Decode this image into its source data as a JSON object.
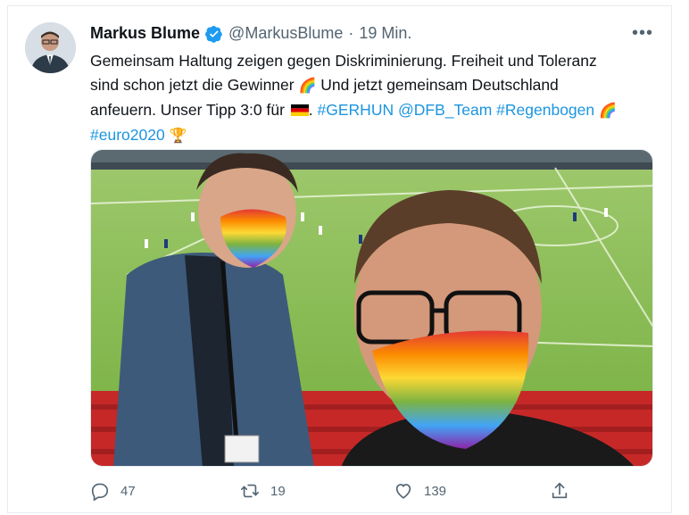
{
  "tweet": {
    "author": {
      "display_name": "Markus Blume",
      "handle": "@MarkusBlume",
      "separator": "·",
      "time": "19 Min."
    },
    "more_label": "•••",
    "text": {
      "line1": "Gemeinsam Haltung zeigen gegen Diskriminierung. Freiheit und Toleranz",
      "line2": "sind schon jetzt die Gewinner",
      "line3": "Und jetzt gemeinsam Deutschland",
      "line4": "anfeuern. Unser Tipp 3:0 für",
      "line4_end": ".",
      "hashtags": [
        "#GERHUN",
        "@DFB_Team",
        "#Regenbogen",
        "#euro2020"
      ]
    },
    "emojis": {
      "rainbow": "🌈",
      "trophy": "🏆"
    },
    "actions": {
      "reply_count": "47",
      "retweet_count": "19",
      "like_count": "139"
    }
  },
  "icons": {
    "verified": "verified-badge-icon",
    "more": "more-options-icon",
    "reply": "reply-icon",
    "retweet": "retweet-icon",
    "like": "heart-icon",
    "share": "share-icon",
    "flag": "german-flag-icon"
  },
  "colors": {
    "link": "#1b95e0",
    "muted": "#536471",
    "verified": "#1d9bf0",
    "text": "#0f1419"
  }
}
